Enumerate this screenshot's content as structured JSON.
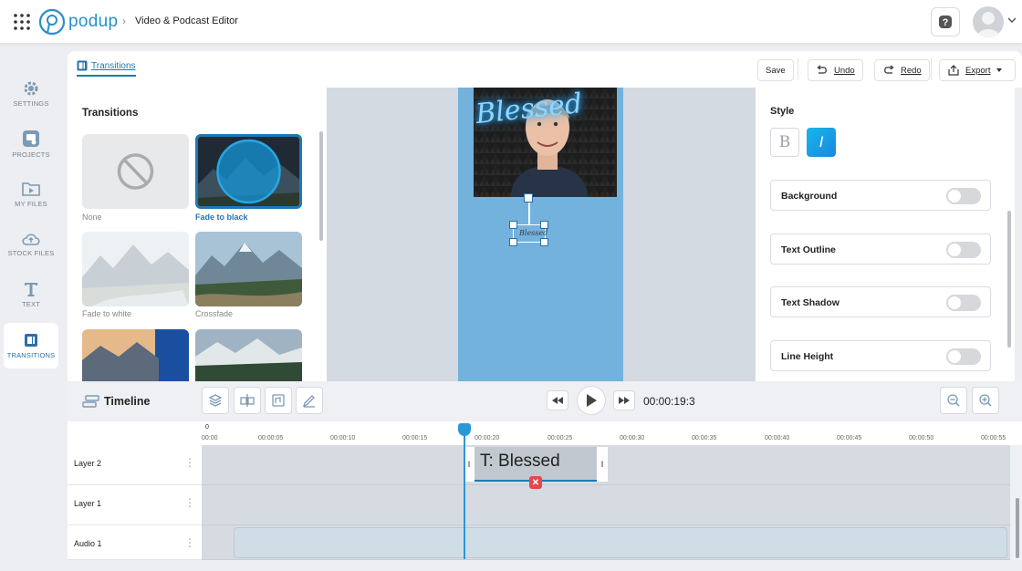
{
  "app": {
    "brand": "podup",
    "breadcrumb_separator": "›",
    "title": "Video & Podcast Editor"
  },
  "sidebar": {
    "items": [
      {
        "label": "SETTINGS",
        "icon": "gear-icon"
      },
      {
        "label": "PROJECTS",
        "icon": "projects-icon"
      },
      {
        "label": "MY FILES",
        "icon": "folder-play-icon"
      },
      {
        "label": "STOCK FILES",
        "icon": "cloud-icon"
      },
      {
        "label": "TEXT",
        "icon": "text-icon"
      },
      {
        "label": "TRANSITIONS",
        "icon": "transitions-icon",
        "active": true
      }
    ]
  },
  "toolbar": {
    "active_tab": "Transitions",
    "save_label": "Save",
    "undo_label": "Undo",
    "redo_label": "Redo",
    "export_label": "Export"
  },
  "transitions_panel": {
    "title": "Transitions",
    "items": [
      {
        "label": "None"
      },
      {
        "label": "Fade to black",
        "selected": true
      },
      {
        "label": "Fade to white"
      },
      {
        "label": "Crossfade"
      }
    ]
  },
  "preview": {
    "video_text": "Blessed",
    "text_element": "Blessed"
  },
  "style_panel": {
    "title": "Style",
    "bold_label": "B",
    "italic_label": "I",
    "italic_active": true,
    "toggles": [
      {
        "label": "Background",
        "on": false
      },
      {
        "label": "Text Outline",
        "on": false
      },
      {
        "label": "Text Shadow",
        "on": false
      },
      {
        "label": "Line Height",
        "on": false
      }
    ]
  },
  "timeline": {
    "title": "Timeline",
    "timecode": "00:00:19:3",
    "ruler_zero": "0",
    "ticks": [
      "00:00",
      "00:00:05",
      "00:00:10",
      "00:00:15",
      "00:00:20",
      "00:00:25",
      "00:00:30",
      "00:00:35",
      "00:00:40",
      "00:00:45",
      "00:00:50",
      "00:00:55"
    ],
    "layers": [
      {
        "name": "Layer 2"
      },
      {
        "name": "Layer 1"
      },
      {
        "name": "Audio 1"
      }
    ],
    "clip_text": "T: Blessed"
  },
  "colors": {
    "accent": "#1f78b4",
    "canvas": "#74b2de",
    "italic_active": "#16a6e6"
  }
}
